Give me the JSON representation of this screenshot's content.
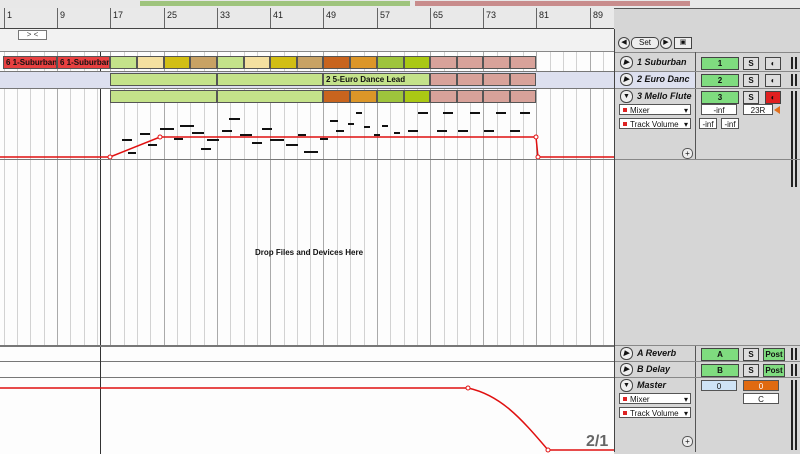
{
  "ruler": {
    "labels": [
      "1",
      "9",
      "17",
      "25",
      "33",
      "41",
      "49",
      "57",
      "65",
      "73",
      "81",
      "89"
    ]
  },
  "loop": {
    "label": "> <"
  },
  "set_button": {
    "label": "Set"
  },
  "tracks": [
    {
      "name": "1 Suburban",
      "num": "1",
      "solo": "S"
    },
    {
      "name": "2 Euro Danc",
      "num": "2",
      "solo": "S"
    },
    {
      "name": "3 Mello Flute",
      "num": "3",
      "solo": "S"
    }
  ],
  "track1_clips": {
    "a": "6 1-Suburban",
    "b": "6 1-Suburban"
  },
  "track2_clip": "2 5-Euro Dance Lead",
  "mixer": {
    "device": "Mixer",
    "param": "Track Volume",
    "vol": "-inf",
    "pan": "23R",
    "send_a": "-inf",
    "send_b": "-inf"
  },
  "drop_text": "Drop Files and Devices Here",
  "returns": [
    {
      "name": "A Reverb",
      "num": "A",
      "solo": "S",
      "post": "Post"
    },
    {
      "name": "B Delay",
      "num": "B",
      "solo": "S",
      "post": "Post"
    }
  ],
  "master": {
    "name": "Master",
    "device": "Mixer",
    "param": "Track Volume",
    "vol": "0",
    "cue": "0",
    "pan": "C"
  },
  "page_indicator": "2/1",
  "colors": {
    "automation": "#e01010",
    "clip_green": "#c4e28a",
    "clip_red": "#d8a29a"
  }
}
